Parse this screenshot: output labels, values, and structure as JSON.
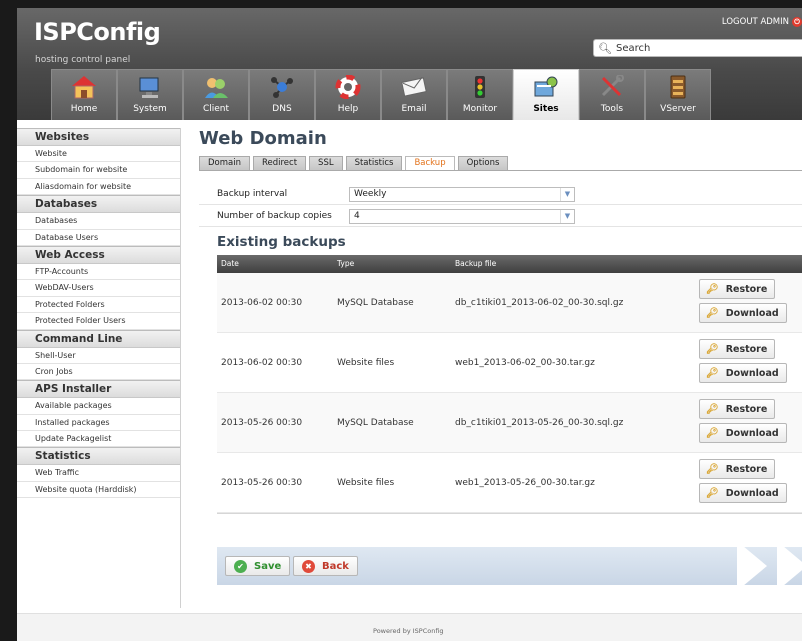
{
  "header": {
    "app_name": "ISPConfig",
    "subtitle": "hosting control panel",
    "logout": "LOGOUT ADMIN",
    "search_placeholder": "Search"
  },
  "modules": [
    {
      "label": "Home",
      "icon": "home-icon"
    },
    {
      "label": "System",
      "icon": "monitor-computer-icon"
    },
    {
      "label": "Client",
      "icon": "users-icon"
    },
    {
      "label": "DNS",
      "icon": "network-nodes-icon"
    },
    {
      "label": "Help",
      "icon": "lifebuoy-icon"
    },
    {
      "label": "Email",
      "icon": "envelope-icon"
    },
    {
      "label": "Monitor",
      "icon": "traffic-light-icon"
    },
    {
      "label": "Sites",
      "icon": "website-icon",
      "active": true
    },
    {
      "label": "Tools",
      "icon": "tools-icon"
    },
    {
      "label": "VServer",
      "icon": "server-icon"
    }
  ],
  "sidebar": [
    {
      "title": "Websites",
      "items": [
        "Website",
        "Subdomain for website",
        "Aliasdomain for website"
      ]
    },
    {
      "title": "Databases",
      "items": [
        "Databases",
        "Database Users"
      ]
    },
    {
      "title": "Web Access",
      "items": [
        "FTP-Accounts",
        "WebDAV-Users",
        "Protected Folders",
        "Protected Folder Users"
      ]
    },
    {
      "title": "Command Line",
      "items": [
        "Shell-User",
        "Cron Jobs"
      ]
    },
    {
      "title": "APS Installer",
      "items": [
        "Available packages",
        "Installed packages",
        "Update Packagelist"
      ]
    },
    {
      "title": "Statistics",
      "items": [
        "Web Traffic",
        "Website quota (Harddisk)"
      ]
    }
  ],
  "main": {
    "title": "Web Domain",
    "tabs": [
      "Domain",
      "Redirect",
      "SSL",
      "Statistics",
      "Backup",
      "Options"
    ],
    "active_tab": "Backup",
    "form": {
      "interval_label": "Backup interval",
      "interval_value": "Weekly",
      "copies_label": "Number of backup copies",
      "copies_value": "4"
    },
    "existing_title": "Existing backups",
    "table": {
      "headers": {
        "date": "Date",
        "type": "Type",
        "file": "Backup file"
      },
      "rows": [
        {
          "date": "2013-06-02 00:30",
          "type": "MySQL Database",
          "file": "db_c1tiki01_2013-06-02_00-30.sql.gz"
        },
        {
          "date": "2013-06-02 00:30",
          "type": "Website files",
          "file": "web1_2013-06-02_00-30.tar.gz"
        },
        {
          "date": "2013-05-26 00:30",
          "type": "MySQL Database",
          "file": "db_c1tiki01_2013-05-26_00-30.sql.gz"
        },
        {
          "date": "2013-05-26 00:30",
          "type": "Website files",
          "file": "web1_2013-05-26_00-30.tar.gz"
        }
      ],
      "restore_label": "Restore",
      "download_label": "Download"
    },
    "save_label": "Save",
    "back_label": "Back"
  },
  "footer": {
    "text": "Powered by ISPConfig"
  },
  "colors": {
    "accent_tab": "#e3731c",
    "header_bg": "#4a4a4a",
    "title": "#3b4a5a"
  }
}
